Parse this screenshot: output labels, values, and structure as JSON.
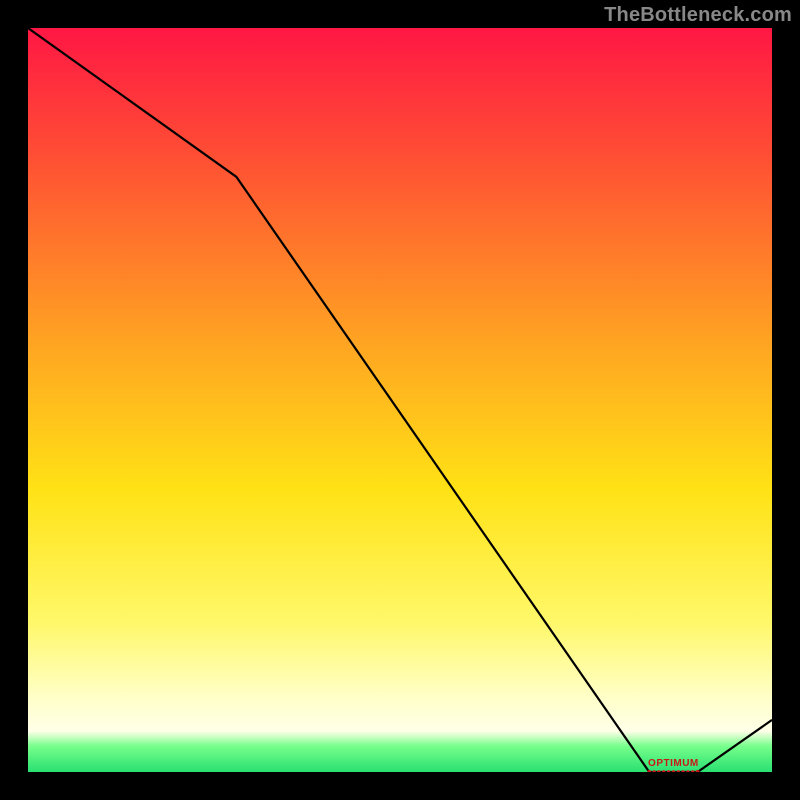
{
  "attribution": "TheBottleneck.com",
  "annotation_label": "OPTIMUM",
  "colors": {
    "gradient": [
      "#ff1744",
      "#ff5133",
      "#ffa322",
      "#ffe215",
      "#fff86a",
      "#ffffc8",
      "#ffffe8",
      "#78ff8c",
      "#28e070"
    ],
    "line": "#000000",
    "marker_stroke": "#c81818",
    "marker_fill": "#c81818"
  },
  "chart_data": {
    "type": "line",
    "x": [
      0.0,
      0.28,
      0.835,
      0.9,
      1.0
    ],
    "values": [
      1.0,
      0.8,
      0.0,
      0.0,
      0.07
    ],
    "optimum_x_range": [
      0.835,
      0.9
    ],
    "optimum_y": 0.0,
    "title": "",
    "xlabel": "",
    "ylabel": "",
    "xlim": [
      0,
      1
    ],
    "ylim": [
      0,
      1
    ],
    "grid": false,
    "legend": false
  }
}
